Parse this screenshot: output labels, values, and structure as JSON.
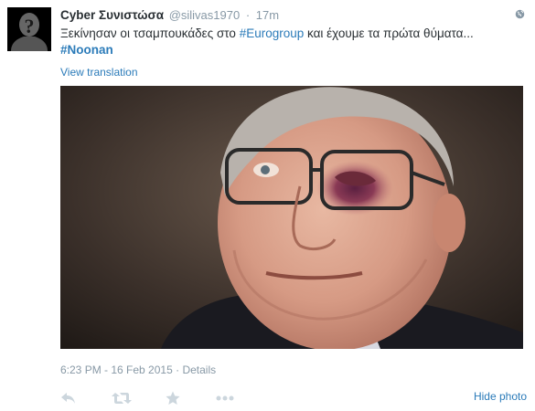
{
  "tweet": {
    "fullname": "Cyber Συνιστώσα",
    "username": "@silivas1970",
    "separator": "·",
    "time": "17m",
    "text_part1": "Ξεκίνησαν οι τσαμπουκάδες στο ",
    "hashtag1": "#Eurogroup",
    "text_part2": " και έχουμε τα πρώτα θύματα...",
    "hashtag2": "#Noonan",
    "view_translation": "View translation",
    "timestamp": "6:23 PM - 16 Feb 2015",
    "meta_separator": "·",
    "details": "Details",
    "hide_photo": "Hide photo"
  },
  "icons": {
    "globe": "globe-icon",
    "reply": "reply-icon",
    "retweet": "retweet-icon",
    "favorite": "star-icon",
    "more": "more-icon"
  },
  "colors": {
    "link": "#2b7bb9",
    "muted": "#8899a6",
    "text": "#292f33"
  }
}
